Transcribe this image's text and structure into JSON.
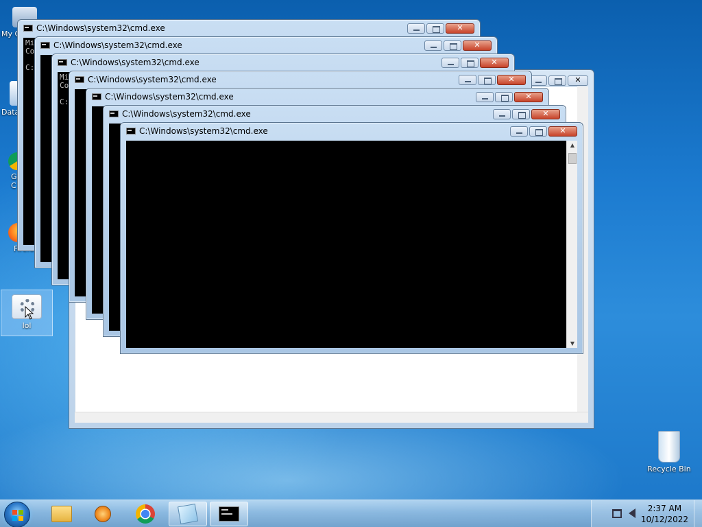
{
  "desktop": {
    "icons": [
      {
        "label": "My C",
        "name": "my-computer"
      },
      {
        "label": "Data",
        "name": "data"
      },
      {
        "label": "G\nC",
        "name": "google-chrome"
      },
      {
        "label": "Firefo",
        "name": "firefox"
      },
      {
        "label": "lol",
        "name": "lol"
      },
      {
        "label": "Recycle Bin",
        "name": "recycle-bin"
      }
    ]
  },
  "windows": [
    {
      "title": "C:\\Windows\\system32\\cmd.exe",
      "console": "Mi\nCo\n\nC: Us"
    },
    {
      "title": "C:\\Windows\\system32\\cmd.exe",
      "console": ""
    },
    {
      "title": "C:\\Windows\\system32\\cmd.exe",
      "console": "Mi\nCo\n\nC:"
    },
    {
      "title": "C:\\Windows\\system32\\cmd.exe",
      "console": ""
    },
    {
      "title": "C:\\Windows\\system32\\cmd.exe",
      "console": ""
    },
    {
      "title": "C:\\Windows\\system32\\cmd.exe",
      "console": ""
    },
    {
      "title": "C:\\Windows\\system32\\cmd.exe",
      "console": ""
    }
  ],
  "taskbar": {
    "clock_time": "2:37 AM",
    "clock_date": "10/12/2022",
    "pinned": [
      "windows-explorer-icon",
      "media-player-icon",
      "chrome-icon",
      "notepad-icon",
      "cmd-icon"
    ]
  }
}
